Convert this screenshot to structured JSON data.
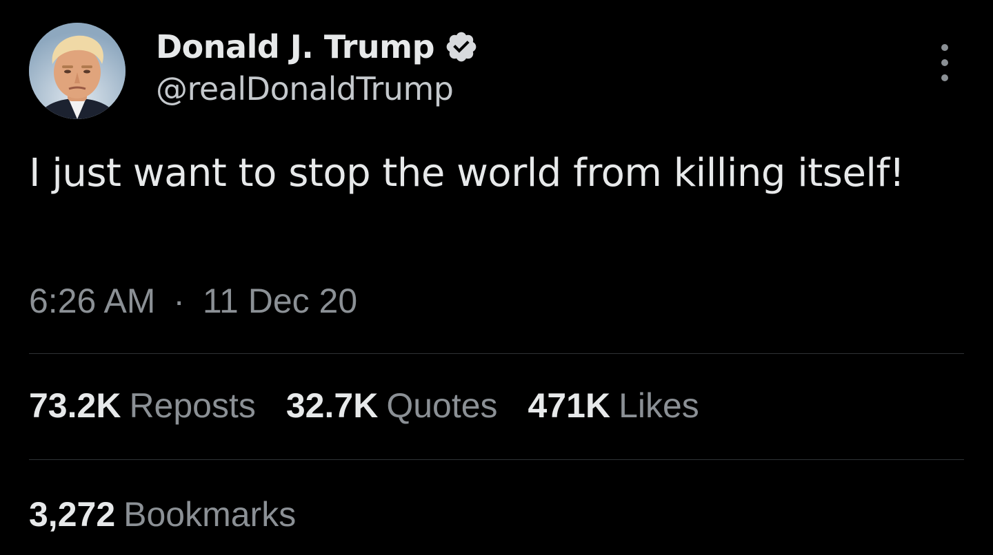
{
  "author": {
    "display_name": "Donald J. Trump",
    "handle": "@realDonaldTrump",
    "verified": true,
    "verified_badge_color": "#1d9bf0",
    "avatar_icon": "profile-photo"
  },
  "tweet": {
    "text": "I just want to stop the world from killing itself!",
    "time": "6:26 AM",
    "separator": "·",
    "date": "11 Dec 20"
  },
  "stats": {
    "reposts_count": "73.2K",
    "reposts_label": "Reposts",
    "quotes_count": "32.7K",
    "quotes_label": "Quotes",
    "likes_count": "471K",
    "likes_label": "Likes",
    "bookmarks_count": "3,272",
    "bookmarks_label": "Bookmarks"
  },
  "icons": {
    "more": "more-vertical-icon",
    "verified": "verified-badge-icon"
  },
  "colors": {
    "background": "#000000",
    "primary_text": "#e7e9ea",
    "secondary_text": "#8b9095",
    "divider": "#2f3336"
  }
}
